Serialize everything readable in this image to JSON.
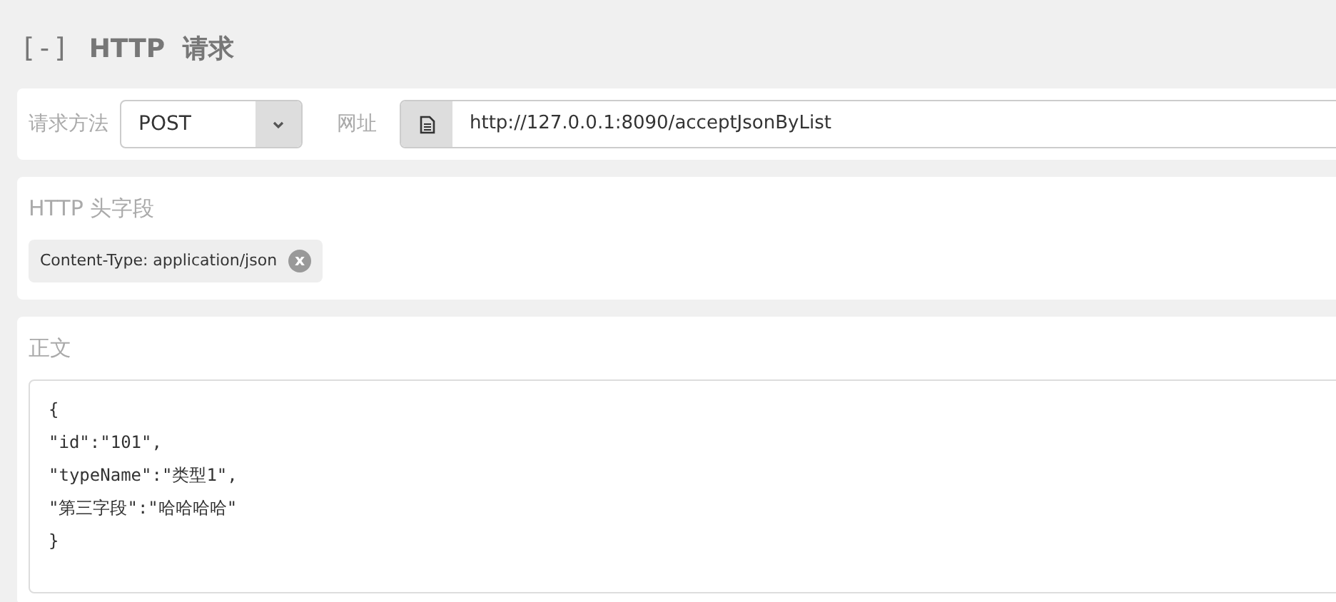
{
  "section": {
    "toggle": "[-]",
    "title": "HTTP  请求"
  },
  "request": {
    "method_label": "请求方法",
    "method": "POST",
    "url_label": "网址",
    "url": "http://127.0.0.1:8090/acceptJsonByList"
  },
  "headers": {
    "title": "HTTP 头字段",
    "tags": [
      {
        "label": "Content-Type: application/json",
        "remove": "x"
      }
    ]
  },
  "body": {
    "title": "正文",
    "lines": [
      "{",
      "\"id\":\"101\",",
      "\"typeName\":\"类型1\",",
      "\"第三字段\":\"哈哈哈哈\"",
      "}"
    ]
  }
}
